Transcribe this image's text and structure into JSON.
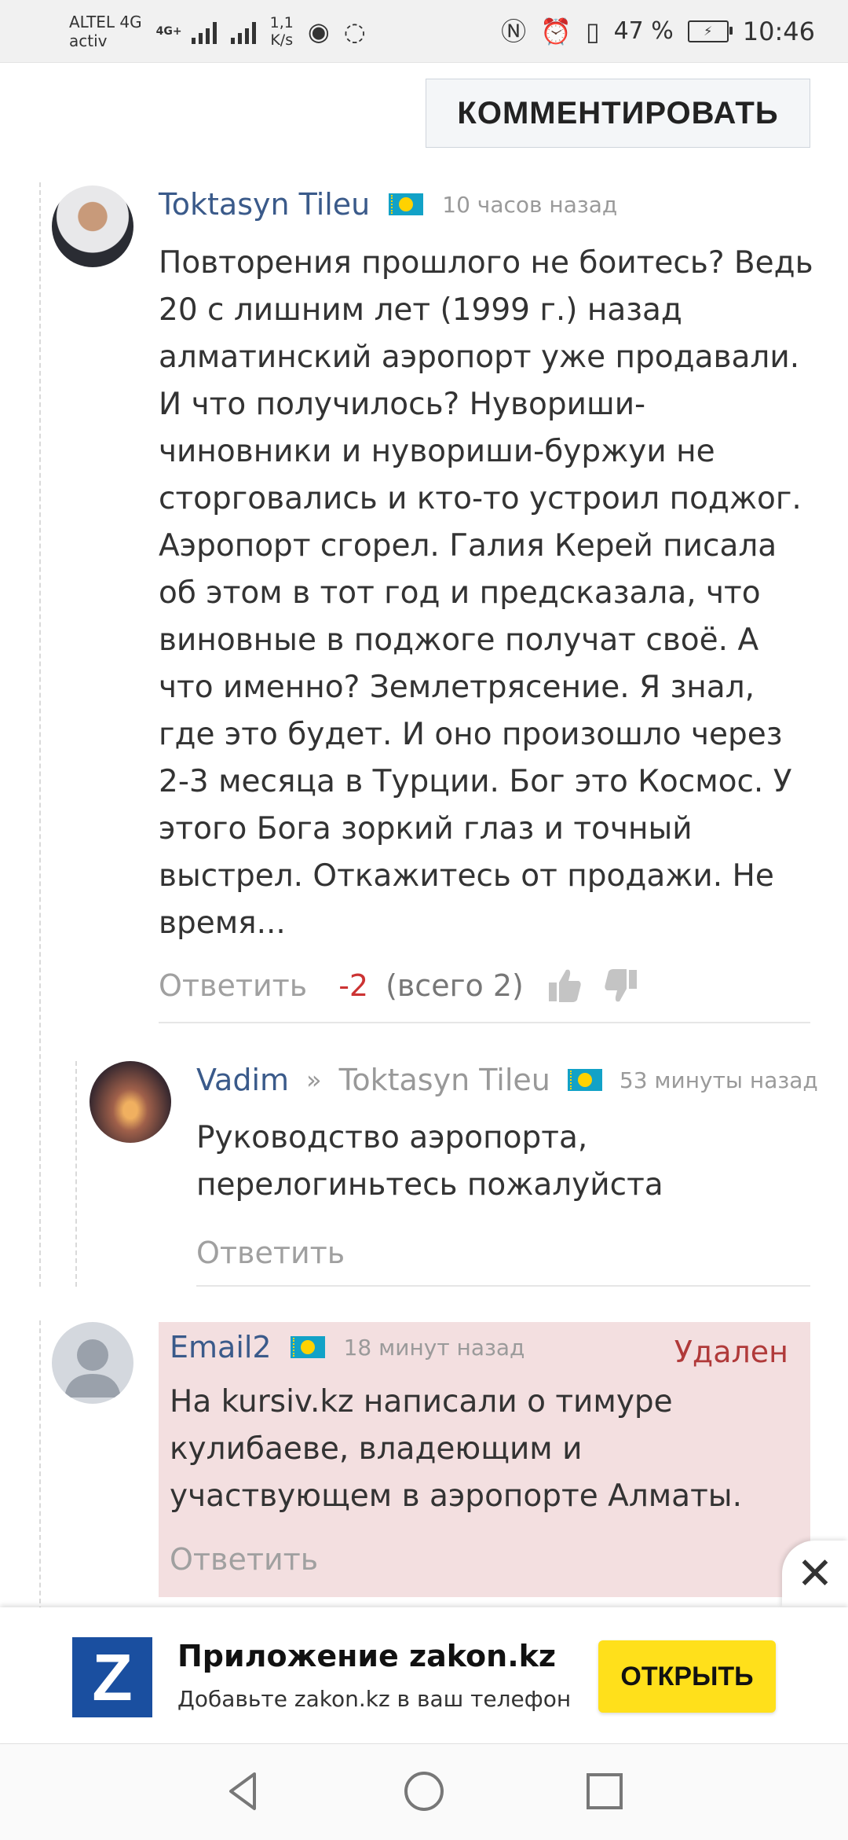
{
  "status": {
    "carrier": "ALTEL 4G",
    "carrier_sub": "activ",
    "net_badge": "4G+",
    "speed_value": "1,1",
    "speed_unit": "K/s",
    "battery": "47 %",
    "time": "10:46"
  },
  "comment_button": "КОММЕНТИРОВАТЬ",
  "comments": [
    {
      "author": "Toktasyn Tileu",
      "time": "10 часов назад",
      "text": "Повторения прошлого не боитесь? Ведь 20 с лишним лет (1999 г.) назад алматинский аэропорт уже продавали. И что получилось? Нувориши-чиновники и нувориши-буржуи не сторговались и кто-то устроил поджог. Аэропорт сгорел. Галия Керей писала об этом в тот год и предсказала, что виновные в поджоге получат своё. А что именно? Землетрясение. Я знал, где это будет. И оно произошло через 2-3 месяца в Турции. Бог это Космос. У этого Бога зоркий глаз и точный выстрел. Откажитесь от продажи. Не время...",
      "reply": "Ответить",
      "rating": "-2",
      "total": "(всего 2)"
    },
    {
      "author": "Vadim",
      "arrow": "»",
      "reply_to": "Toktasyn Tileu",
      "time": "53 минуты назад",
      "text": "Руководство аэропорта, перелогиньтесь пожалуйста",
      "reply": "Ответить"
    },
    {
      "author": "Email2",
      "time": "18 минут назад",
      "status": "Удален",
      "text": "На kursiv.kz написали о тимуре кулибаеве, владеющим и участвующем в аэропорте Алматы.",
      "reply": "Ответить"
    }
  ],
  "banner": {
    "logo_letter": "Z",
    "title": "Приложение zakon.kz",
    "subtitle": "Добавьте zakon.kz в ваш телефон",
    "open_label": "ОТКРЫТЬ",
    "close_glyph": "✕"
  },
  "colors": {
    "author": "#3a5a8a",
    "rating_negative": "#cc3333",
    "deleted_bg": "#f3dfe0",
    "deleted_label": "#b03a3a",
    "open_button": "#ffe01b",
    "logo_bg": "#1a4fa0"
  }
}
